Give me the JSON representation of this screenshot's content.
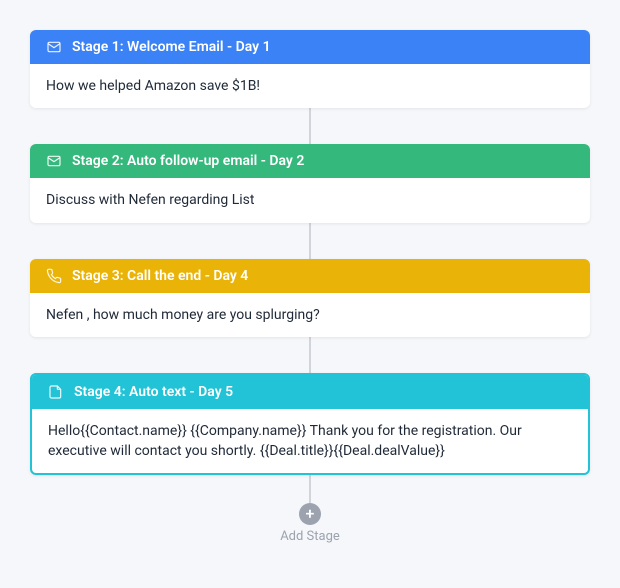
{
  "stages": [
    {
      "color": "blue",
      "iconName": "envelope-icon",
      "headerText": "Stage 1: Welcome Email - Day 1",
      "bodyText": "How we helped Amazon save $1B!"
    },
    {
      "color": "green",
      "iconName": "envelope-icon",
      "headerText": "Stage 2: Auto follow-up email - Day 2",
      "bodyText": "Discuss with Nefen regarding List"
    },
    {
      "color": "yellow",
      "iconName": "phone-icon",
      "headerText": "Stage 3: Call the end - Day 4",
      "bodyText": "Nefen , how much money are you splurging?"
    },
    {
      "color": "teal",
      "iconName": "text-icon",
      "headerText": "Stage 4: Auto text  - Day 5",
      "bodyText": "Hello{{Contact.name}} {{Company.name}} Thank you for the registration. Our executive will contact you shortly. {{Deal.title}}{{Deal.dealValue}}"
    }
  ],
  "addStage": {
    "label": "Add Stage"
  }
}
